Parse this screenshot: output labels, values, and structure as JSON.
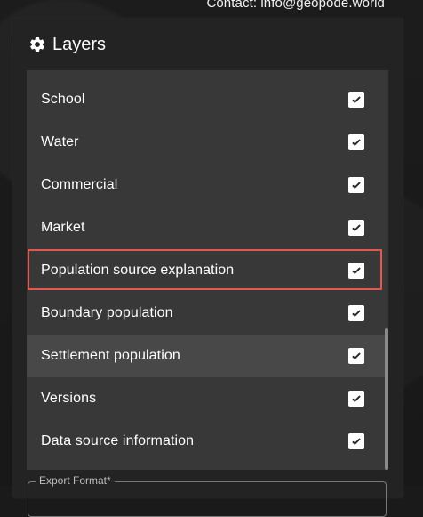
{
  "contact": {
    "text": "Contact: info@geopode.world"
  },
  "panel": {
    "title": "Layers",
    "icon": "gear-icon"
  },
  "layers": [
    {
      "label": "School",
      "checked": true
    },
    {
      "label": "Water",
      "checked": true
    },
    {
      "label": "Commercial",
      "checked": true
    },
    {
      "label": "Market",
      "checked": true
    },
    {
      "label": "Population source explanation",
      "checked": true
    },
    {
      "label": "Boundary population",
      "checked": true
    },
    {
      "label": "Settlement population",
      "checked": true
    },
    {
      "label": "Versions",
      "checked": true
    },
    {
      "label": "Data source information",
      "checked": true
    }
  ],
  "export": {
    "label": "Export Format*"
  },
  "colors": {
    "highlight_border": "#e05a54",
    "row_hover": "#484848",
    "panel_bg": "#232323",
    "list_bg": "#383838"
  }
}
